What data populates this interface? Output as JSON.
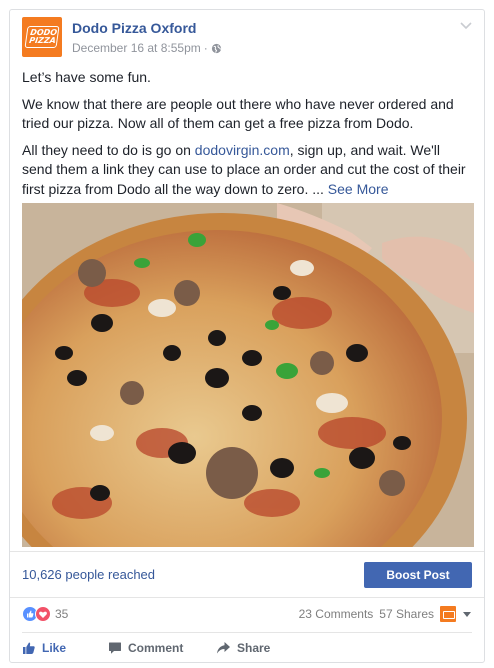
{
  "post": {
    "page_name": "Dodo Pizza Oxford",
    "logo_text": [
      "DODO",
      "PIZZA"
    ],
    "date": "December 16 at 8:55pm",
    "separator": "·",
    "visibility_icon": "globe-icon",
    "menu_icon": "chevron-down-icon",
    "paragraphs": {
      "p1": "Let’s have some fun.",
      "p2": "We know that there are people out there who have never ordered and tried our pizza. Now all of them can get a free pizza from Dodo.",
      "p3_before": "All they need to do is go on ",
      "p3_link": "dodovirgin.com",
      "p3_after": ", sign up, and wait. We'll send them a link they can use to place an order and cut the cost of their first pizza from Dodo all the way down to zero. ... ",
      "see_more": "See More"
    }
  },
  "insights": {
    "reach_text": "10,626 people reached",
    "boost_label": "Boost Post"
  },
  "stats": {
    "reactions_icons": [
      "like-reaction-icon",
      "love-reaction-icon"
    ],
    "reactions_count": "35",
    "comments": "23 Comments",
    "shares": "57 Shares"
  },
  "actions": {
    "like": "Like",
    "comment": "Comment",
    "share": "Share"
  },
  "colors": {
    "brand_orange": "#f47b20",
    "link_blue": "#365899",
    "button_blue": "#4267b2",
    "love_red": "#f25268"
  }
}
